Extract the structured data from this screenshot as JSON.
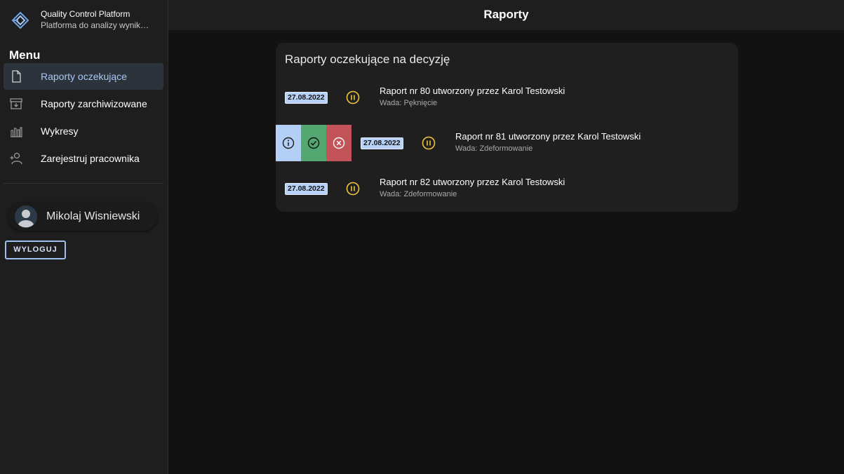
{
  "app": {
    "name": "Quality Control Platform",
    "subtitle": "Platforma do analizy wyników"
  },
  "sidebar": {
    "menu_title": "Menu",
    "items": [
      {
        "label": "Raporty oczekujące",
        "icon": "document-icon",
        "active": true
      },
      {
        "label": "Raporty zarchiwizowane",
        "icon": "archive-icon",
        "active": false
      },
      {
        "label": "Wykresy",
        "icon": "bar-chart-icon",
        "active": false
      },
      {
        "label": "Zarejestruj pracownika",
        "icon": "add-user-icon",
        "active": false
      }
    ],
    "user_name": "Mikolaj Wisniewski",
    "logout_label": "WYLOGUJ"
  },
  "header": {
    "title": "Raporty"
  },
  "reports_card": {
    "title": "Raporty oczekujące na decyzję",
    "reports": [
      {
        "date": "27.08.2022",
        "title": "Raport nr 80 utworzony przez Karol Testowski",
        "defect": "Wada: Pęknięcie",
        "status": "paused",
        "actions_open": false
      },
      {
        "date": "27.08.2022",
        "title": "Raport nr 81 utworzony przez Karol Testowski",
        "defect": "Wada: Zdeformowanie",
        "status": "paused",
        "actions_open": true
      },
      {
        "date": "27.08.2022",
        "title": "Raport nr 82 utworzony przez Karol Testowski",
        "defect": "Wada: Zdeformowanie",
        "status": "paused",
        "actions_open": false
      }
    ]
  },
  "colors": {
    "accent": "#a9c8f5",
    "status_pending": "#f0c43c",
    "approve": "#52a86e",
    "reject": "#c25358",
    "info": "#b3cff6"
  }
}
